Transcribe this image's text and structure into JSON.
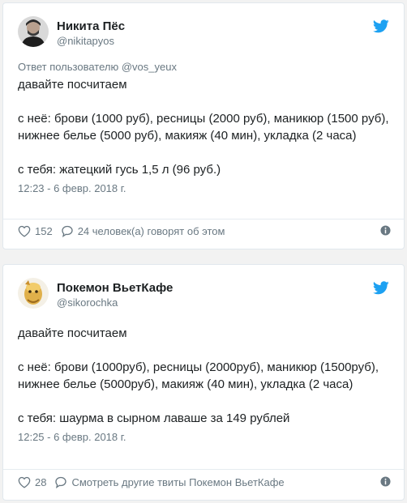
{
  "tweets": [
    {
      "author": {
        "name": "Никита Пёс",
        "handle": "@nikitapyos"
      },
      "reply_to": "Ответ пользователю @vos_yeux",
      "paragraphs": [
        "давайте посчитаем",
        "с неё: брови (1000 руб), ресницы (2000 руб), маникюр (1500 руб), нижнее белье (5000 руб), макияж (40 мин), укладка (2 часа)",
        "с тебя: жатецкий гусь 1,5 л (96 руб.)"
      ],
      "timestamp": "12:23 - 6 февр. 2018 г.",
      "likes": "152",
      "comments_label": "24 человек(а) говорят об этом",
      "icons": {
        "bird": "twitter-bird-icon",
        "like": "heart-icon",
        "comment": "speech-bubble-icon",
        "info": "info-icon"
      }
    },
    {
      "author": {
        "name": "Покемон ВьетКафе",
        "handle": "@sikorochka"
      },
      "paragraphs": [
        "давайте посчитаем",
        "с неё: брови (1000руб), ресницы (2000руб), маникюр (1500руб), нижнее белье (5000руб), макияж (40 мин), укладка (2 часа)",
        "с тебя: шаурма в сырном лаваше за 149 рублей"
      ],
      "timestamp": "12:25 - 6 февр. 2018 г.",
      "likes": "28",
      "comments_label": "Смотреть другие твиты Покемон ВьетКафе",
      "icons": {
        "bird": "twitter-bird-icon",
        "like": "heart-icon",
        "comment": "speech-bubble-icon",
        "info": "info-icon"
      }
    }
  ],
  "colors": {
    "twitter_blue": "#1da1f2",
    "text": "#1c2022",
    "muted": "#697882",
    "border": "#e1e8ed"
  }
}
